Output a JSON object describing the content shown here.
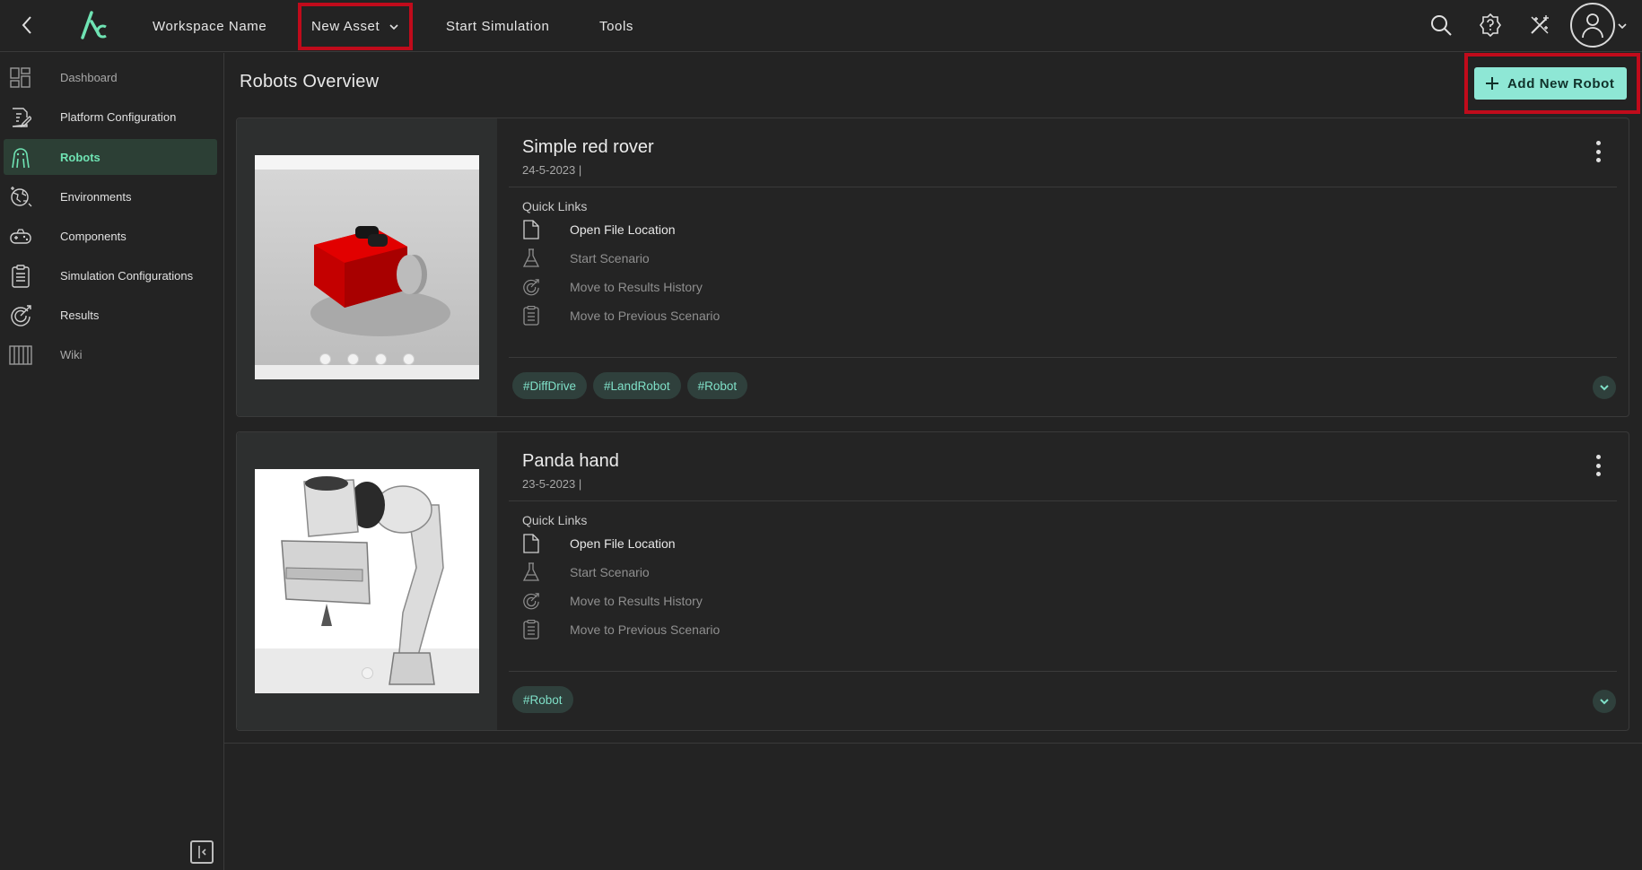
{
  "topbar": {
    "workspace_name": "Workspace Name",
    "new_asset_label": "New Asset",
    "start_simulation_label": "Start Simulation",
    "tools_label": "Tools"
  },
  "sidebar": {
    "items": [
      {
        "label": "Dashboard",
        "icon": "dashboard-icon"
      },
      {
        "label": "Platform Configuration",
        "icon": "platform-config-icon"
      },
      {
        "label": "Robots",
        "icon": "robot-icon",
        "active": true
      },
      {
        "label": "Environments",
        "icon": "environment-icon"
      },
      {
        "label": "Components",
        "icon": "components-icon"
      },
      {
        "label": "Simulation Configurations",
        "icon": "clipboard-icon"
      },
      {
        "label": "Results",
        "icon": "results-icon"
      },
      {
        "label": "Wiki",
        "icon": "wiki-icon"
      }
    ]
  },
  "main": {
    "title": "Robots Overview",
    "add_button_label": "Add New Robot"
  },
  "robots": [
    {
      "name": "Simple red rover",
      "date": "24-5-2023 |",
      "quick_links_title": "Quick Links",
      "links": [
        {
          "label": "Open File Location",
          "icon": "file-icon",
          "enabled": true
        },
        {
          "label": "Start Scenario",
          "icon": "flask-icon",
          "enabled": false
        },
        {
          "label": "Move to Results History",
          "icon": "results-history-icon",
          "enabled": false
        },
        {
          "label": "Move to Previous Scenario",
          "icon": "clipboard-icon",
          "enabled": false
        }
      ],
      "tags": [
        "#DiffDrive",
        "#LandRobot",
        "#Robot"
      ],
      "image_count": 4
    },
    {
      "name": "Panda hand",
      "date": "23-5-2023 |",
      "quick_links_title": "Quick Links",
      "links": [
        {
          "label": "Open File Location",
          "icon": "file-icon",
          "enabled": true
        },
        {
          "label": "Start Scenario",
          "icon": "flask-icon",
          "enabled": false
        },
        {
          "label": "Move to Results History",
          "icon": "results-history-icon",
          "enabled": false
        },
        {
          "label": "Move to Previous Scenario",
          "icon": "clipboard-icon",
          "enabled": false
        }
      ],
      "tags": [
        "#Robot"
      ],
      "image_count": 1
    }
  ],
  "colors": {
    "accent": "#6fe3b3",
    "button": "#8ee7d5",
    "highlight_border": "#c00b1b",
    "background": "#232323"
  }
}
